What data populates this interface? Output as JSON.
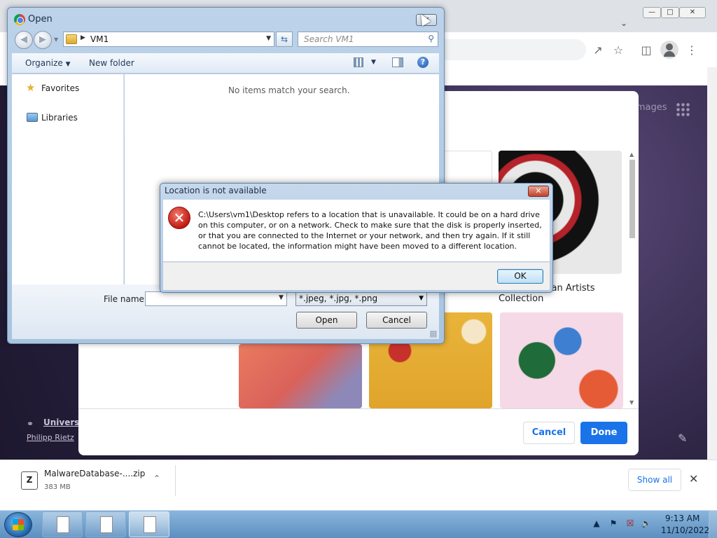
{
  "open_dialog": {
    "title": "Open",
    "path": "VM1",
    "search_placeholder": "Search VM1",
    "organize_label": "Organize",
    "new_folder_label": "New folder",
    "nav_favorites": "Favorites",
    "nav_libraries": "Libraries",
    "empty_message": "No items match your search.",
    "file_name_label": "File name:",
    "file_name_value": "",
    "filter_value": "*.jpeg, *.jpg, *.png",
    "open_label": "Open",
    "cancel_label": "Cancel"
  },
  "error_dialog": {
    "title": "Location is not available",
    "message": "C:\\Users\\vm1\\Desktop refers to a location that is unavailable. It could be on a hard drive on this computer, or on a network. Check to make sure that the disk is properly inserted, or that you are connected to the Internet or your network, and then try again. If it still cannot be located, the information might have been moved to a different location.",
    "ok_label": "OK"
  },
  "chrome": {
    "images_link": "Images",
    "collection_caption_line1": "...can Artists",
    "collection_caption_line2": "Collection",
    "attribution_title": "Universe",
    "attribution_author": "Philipp Rietz",
    "cancel_label": "Cancel",
    "done_label": "Done"
  },
  "download": {
    "file_name": "MalwareDatabase-....zip",
    "file_size": "383 MB",
    "show_all_label": "Show all"
  },
  "taskbar": {
    "time": "9:13 AM",
    "date": "11/10/2022"
  },
  "colors": {
    "chrome_blue": "#1a73e8",
    "error_red": "#c11a12",
    "taskbar_blue": "#5c8fc0"
  },
  "icons": [
    "chrome-icon",
    "back-icon",
    "forward-icon",
    "folder-icon",
    "refresh-icon",
    "search-icon",
    "views-icon",
    "preview-pane-icon",
    "help-icon",
    "star-icon",
    "libraries-icon",
    "error-icon",
    "share-icon",
    "bookmark-star-icon",
    "side-panel-icon",
    "profile-icon",
    "menu-icon",
    "apps-icon",
    "link-icon",
    "pencil-icon",
    "zip-file-icon",
    "windows-start-icon",
    "network-icon",
    "volume-icon"
  ]
}
